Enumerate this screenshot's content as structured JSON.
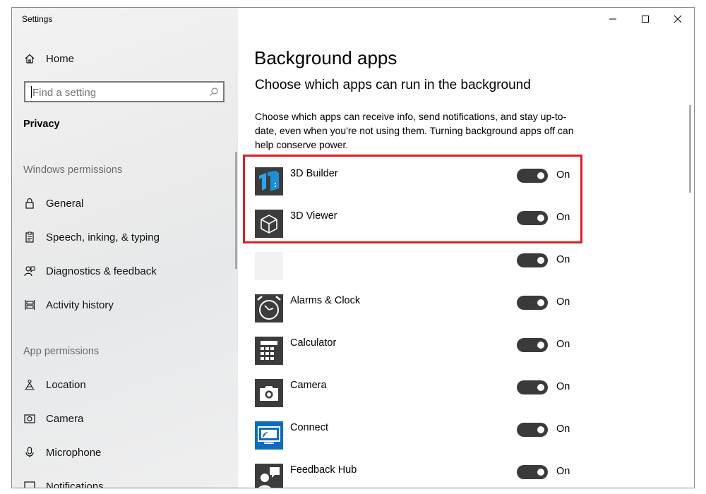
{
  "window": {
    "title": "Settings"
  },
  "sidebar": {
    "home_label": "Home",
    "search_placeholder": "Find a setting",
    "category": "Privacy",
    "windows_permissions_label": "Windows permissions",
    "windows_permissions_items": [
      {
        "label": "General",
        "icon": "lock-icon"
      },
      {
        "label": "Speech, inking, & typing",
        "icon": "speech-icon"
      },
      {
        "label": "Diagnostics & feedback",
        "icon": "feedback-icon"
      },
      {
        "label": "Activity history",
        "icon": "activity-history-icon"
      }
    ],
    "app_permissions_label": "App permissions",
    "app_permissions_items": [
      {
        "label": "Location",
        "icon": "location-icon"
      },
      {
        "label": "Camera",
        "icon": "camera-icon"
      },
      {
        "label": "Microphone",
        "icon": "microphone-icon"
      },
      {
        "label": "Notifications",
        "icon": "notifications-icon"
      }
    ]
  },
  "main": {
    "title": "Background apps",
    "subtitle": "Choose which apps can run in the background",
    "description": "Choose which apps can receive info, send notifications, and stay up-to-date, even when you're not using them. Turning background apps off can help conserve power.",
    "apps": [
      {
        "name": "3D Builder",
        "state": "On",
        "icon": "3d-builder-icon",
        "icon_color": "#3c3c3c"
      },
      {
        "name": "3D Viewer",
        "state": "On",
        "icon": "3d-viewer-icon",
        "icon_color": "#3c3c3c"
      },
      {
        "name": "",
        "state": "On",
        "icon": "blank-app-icon",
        "icon_color": "#f2f2f2"
      },
      {
        "name": "Alarms & Clock",
        "state": "On",
        "icon": "alarm-clock-icon",
        "icon_color": "#3c3c3c"
      },
      {
        "name": "Calculator",
        "state": "On",
        "icon": "calculator-icon",
        "icon_color": "#3c3c3c"
      },
      {
        "name": "Camera",
        "state": "On",
        "icon": "camera-app-icon",
        "icon_color": "#3c3c3c"
      },
      {
        "name": "Connect",
        "state": "On",
        "icon": "connect-icon",
        "icon_color": "#0f6cbd"
      },
      {
        "name": "Feedback Hub",
        "state": "On",
        "icon": "feedback-hub-icon",
        "icon_color": "#3c3c3c"
      }
    ]
  },
  "colors": {
    "highlight": "#e01b24",
    "toggle_on": "#3a3a3a",
    "accent_blue": "#1e88e5"
  }
}
